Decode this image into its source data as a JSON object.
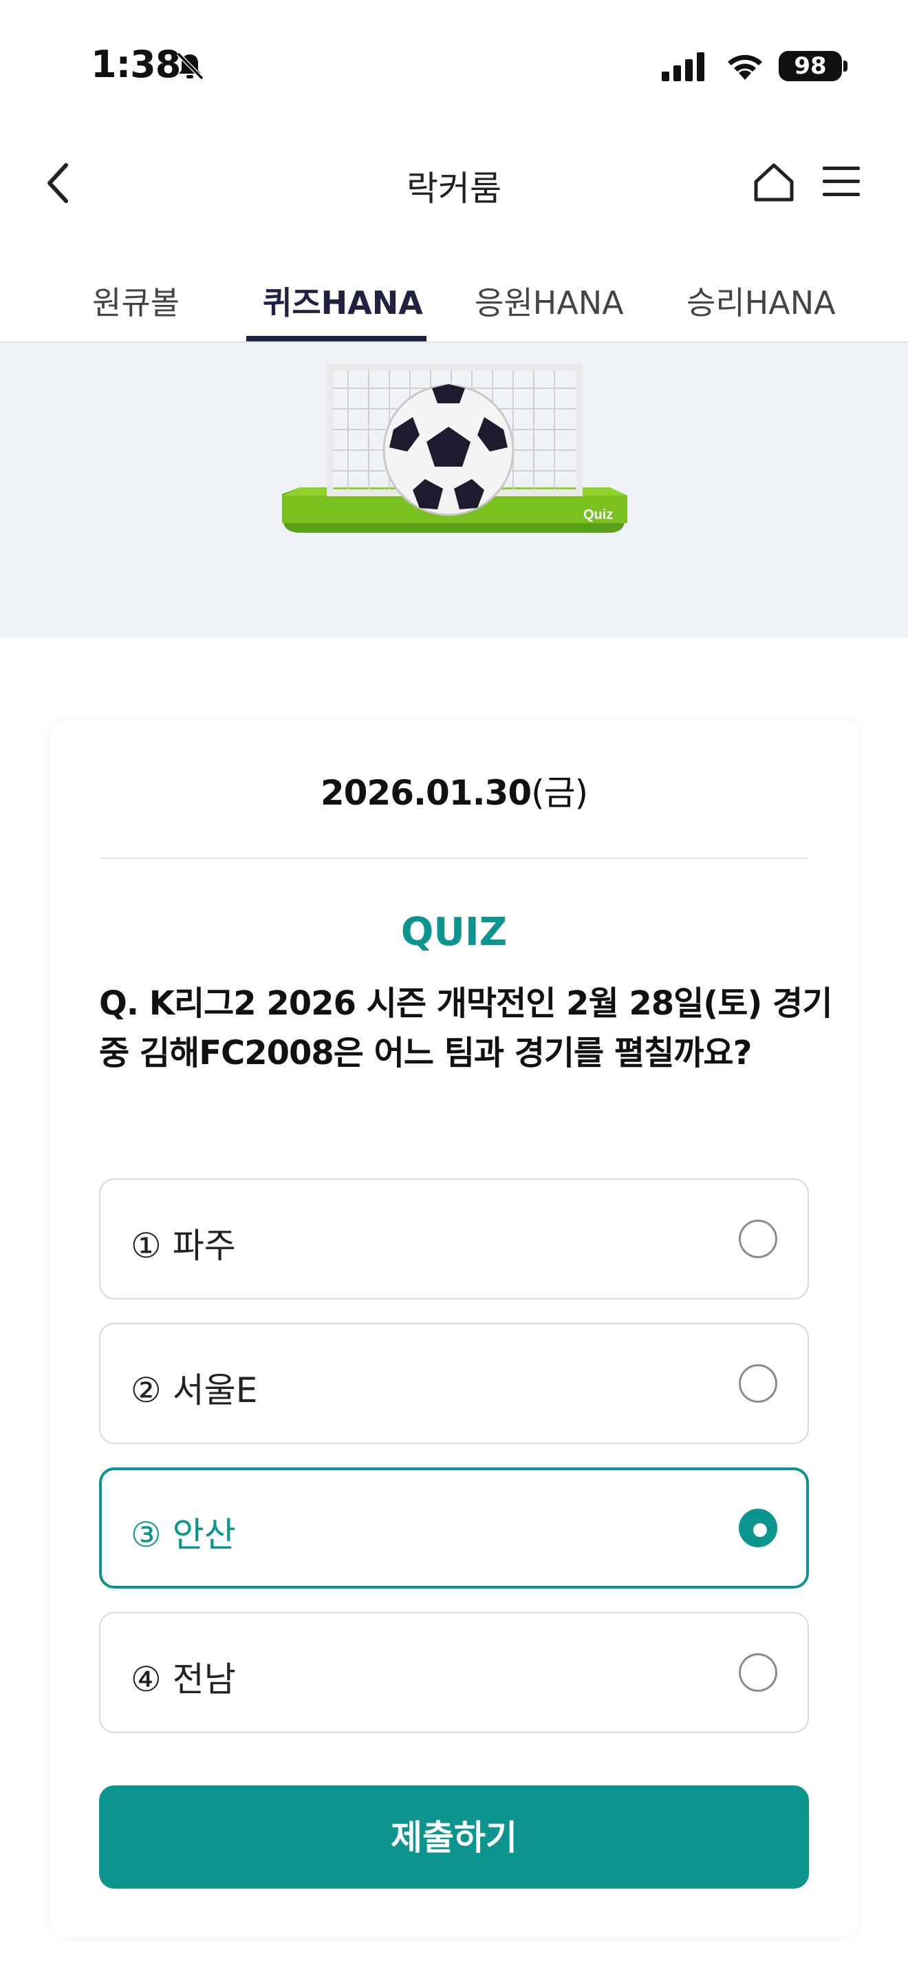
{
  "status_bar": {
    "time": "1:38",
    "battery": "98",
    "icons": [
      "bell-slash-icon",
      "signal-icon",
      "wifi-icon",
      "battery-icon"
    ]
  },
  "header": {
    "title": "락커룸",
    "back_icon": "chevron-left-icon",
    "home_icon": "home-icon",
    "menu_icon": "hamburger-menu-icon"
  },
  "tabs": [
    {
      "label": "원큐볼",
      "active": false
    },
    {
      "label": "퀴즈HANA",
      "active": true
    },
    {
      "label": "응원HANA",
      "active": false
    },
    {
      "label": "승리HANA",
      "active": false
    }
  ],
  "banner": {
    "art_text": "Quiz"
  },
  "quiz": {
    "date": "2026.01.30",
    "day_of_week": "(금)",
    "label": "QUIZ",
    "question": "Q. K리그2 2026 시즌 개막전인 2월 28일(토) 경기 중 김해FC2008은 어느 팀과 경기를 펼칠까요?",
    "options": [
      {
        "label": "① 파주",
        "selected": false
      },
      {
        "label": "② 서울E",
        "selected": false
      },
      {
        "label": "③ 안산",
        "selected": true
      },
      {
        "label": "④ 전남",
        "selected": false
      }
    ],
    "submit_label": "제출하기"
  },
  "colors": {
    "accent": "#0b958e",
    "tab_active": "#1f2240",
    "banner_bg": "#eff2f6"
  }
}
